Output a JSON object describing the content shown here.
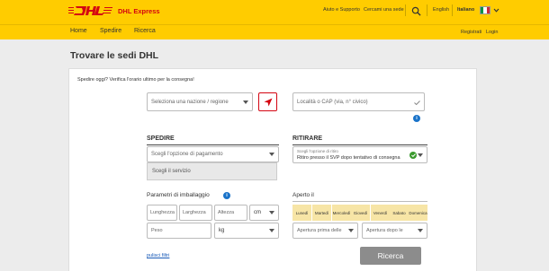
{
  "header": {
    "brand": "DHL Express",
    "links": {
      "help": "Aiuto e Supporto",
      "find": "Cercami una sede",
      "english": "English",
      "italiano": "Italiano"
    }
  },
  "nav": {
    "items": [
      "Home",
      "Spedire",
      "Ricerca"
    ],
    "register": "Registrati",
    "login": "Login"
  },
  "page": {
    "title": "Trovare le sedi DHL",
    "hint": "Spedire oggi? Verifica l'orario ultimo per la consegna!"
  },
  "search": {
    "country_placeholder": "Seleziona una nazione / regione",
    "locality_placeholder": "Località o CAP (via, n° civico)"
  },
  "spedire": {
    "heading": "SPEDIRE",
    "payment_placeholder": "Scegli l'opzione di pagamento",
    "service_option": "Scegli il servizio"
  },
  "ritirare": {
    "heading": "RITIRARE",
    "option_label": "Scegli l'opzione di ritiro",
    "option_value": "Ritiro presso il SVP dopo tentativo di consegna"
  },
  "parametri": {
    "heading": "Parametri di imballaggio",
    "lunghezza": "Lunghezza",
    "larghezza": "Larghezza",
    "altezza": "Altezza",
    "unit_length": "cm",
    "peso": "Peso",
    "unit_weight": "kg"
  },
  "aperto": {
    "heading": "Aperto il",
    "days": [
      "Lunedì",
      "Martedì",
      "Mercoledì",
      "Giovedì",
      "Venerdì",
      "Sabato",
      "Domenica"
    ],
    "opening_before": "Apertura prima delle",
    "opening_after": "Apertura dopo le"
  },
  "actions": {
    "clear": "pulisci filtri",
    "search": "Ricerca"
  },
  "colors": {
    "dhl_yellow": "#ffcc00",
    "dhl_red": "#d40511",
    "day_chip": "#f7e5a6",
    "button_gray": "#8c8c8c"
  },
  "icons": [
    "search-icon",
    "flag-icon",
    "chevron-down-icon",
    "location-arrow-icon",
    "info-icon",
    "check-icon"
  ]
}
